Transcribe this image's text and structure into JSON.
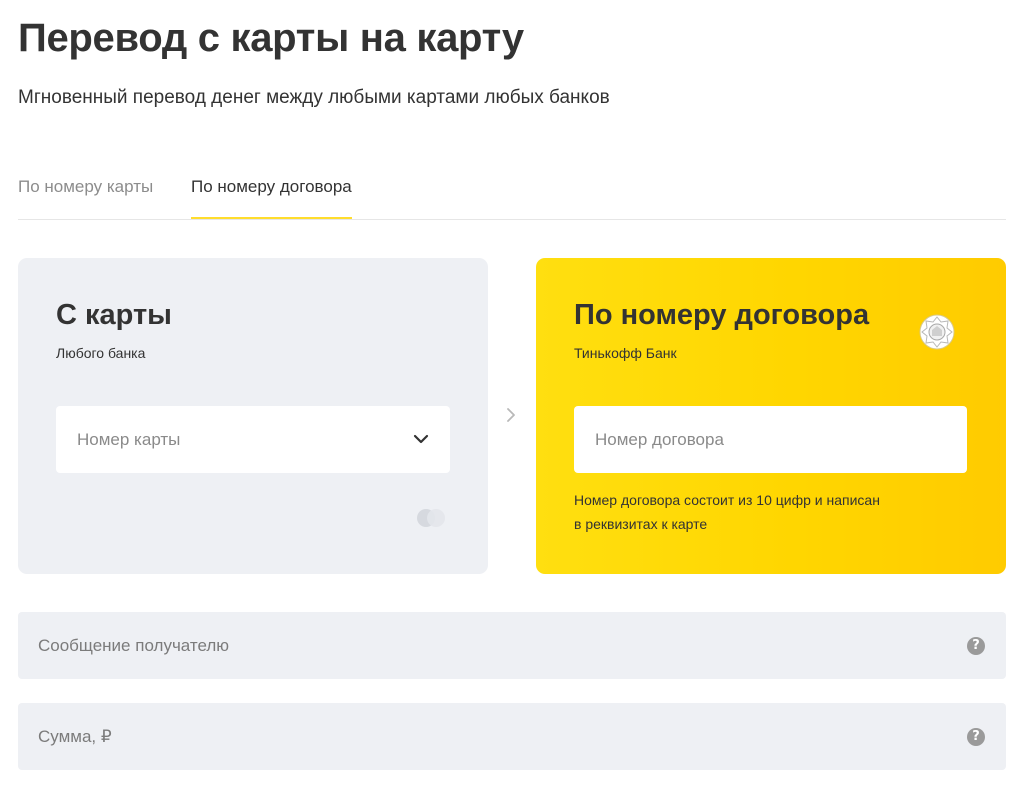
{
  "page": {
    "title": "Перевод с карты на карту",
    "subtitle": "Мгновенный перевод денег между любыми картами любых банков"
  },
  "tabs": [
    {
      "label": "По номеру карты",
      "active": false
    },
    {
      "label": "По номеру договора",
      "active": true
    }
  ],
  "from_card": {
    "title": "С карты",
    "subtitle": "Любого банка",
    "card_number_placeholder": "Номер карты",
    "card_number_value": ""
  },
  "to_card": {
    "title": "По номеру договора",
    "subtitle": "Тинькофф Банк",
    "contract_placeholder": "Номер договора",
    "contract_value": "",
    "hint_line1": "Номер договора состоит из 10 цифр и написан",
    "hint_line2": "в реквизитах к карте"
  },
  "message": {
    "placeholder": "Сообщение получателю",
    "value": "",
    "help": "?"
  },
  "amount": {
    "placeholder": "Сумма, ₽",
    "value": "",
    "help": "?"
  },
  "colors": {
    "accent_yellow": "#ffdd2d",
    "card_grey": "#eef0f4",
    "text_dark": "#333333",
    "text_muted": "#8c8c8c"
  },
  "icons": {
    "dropdown": "chevron-down-icon",
    "transfer_arrow": "chevron-right-icon",
    "payment_system": "payment-system-icon",
    "bank_logo": "bank-logo-icon",
    "help": "help-icon"
  }
}
